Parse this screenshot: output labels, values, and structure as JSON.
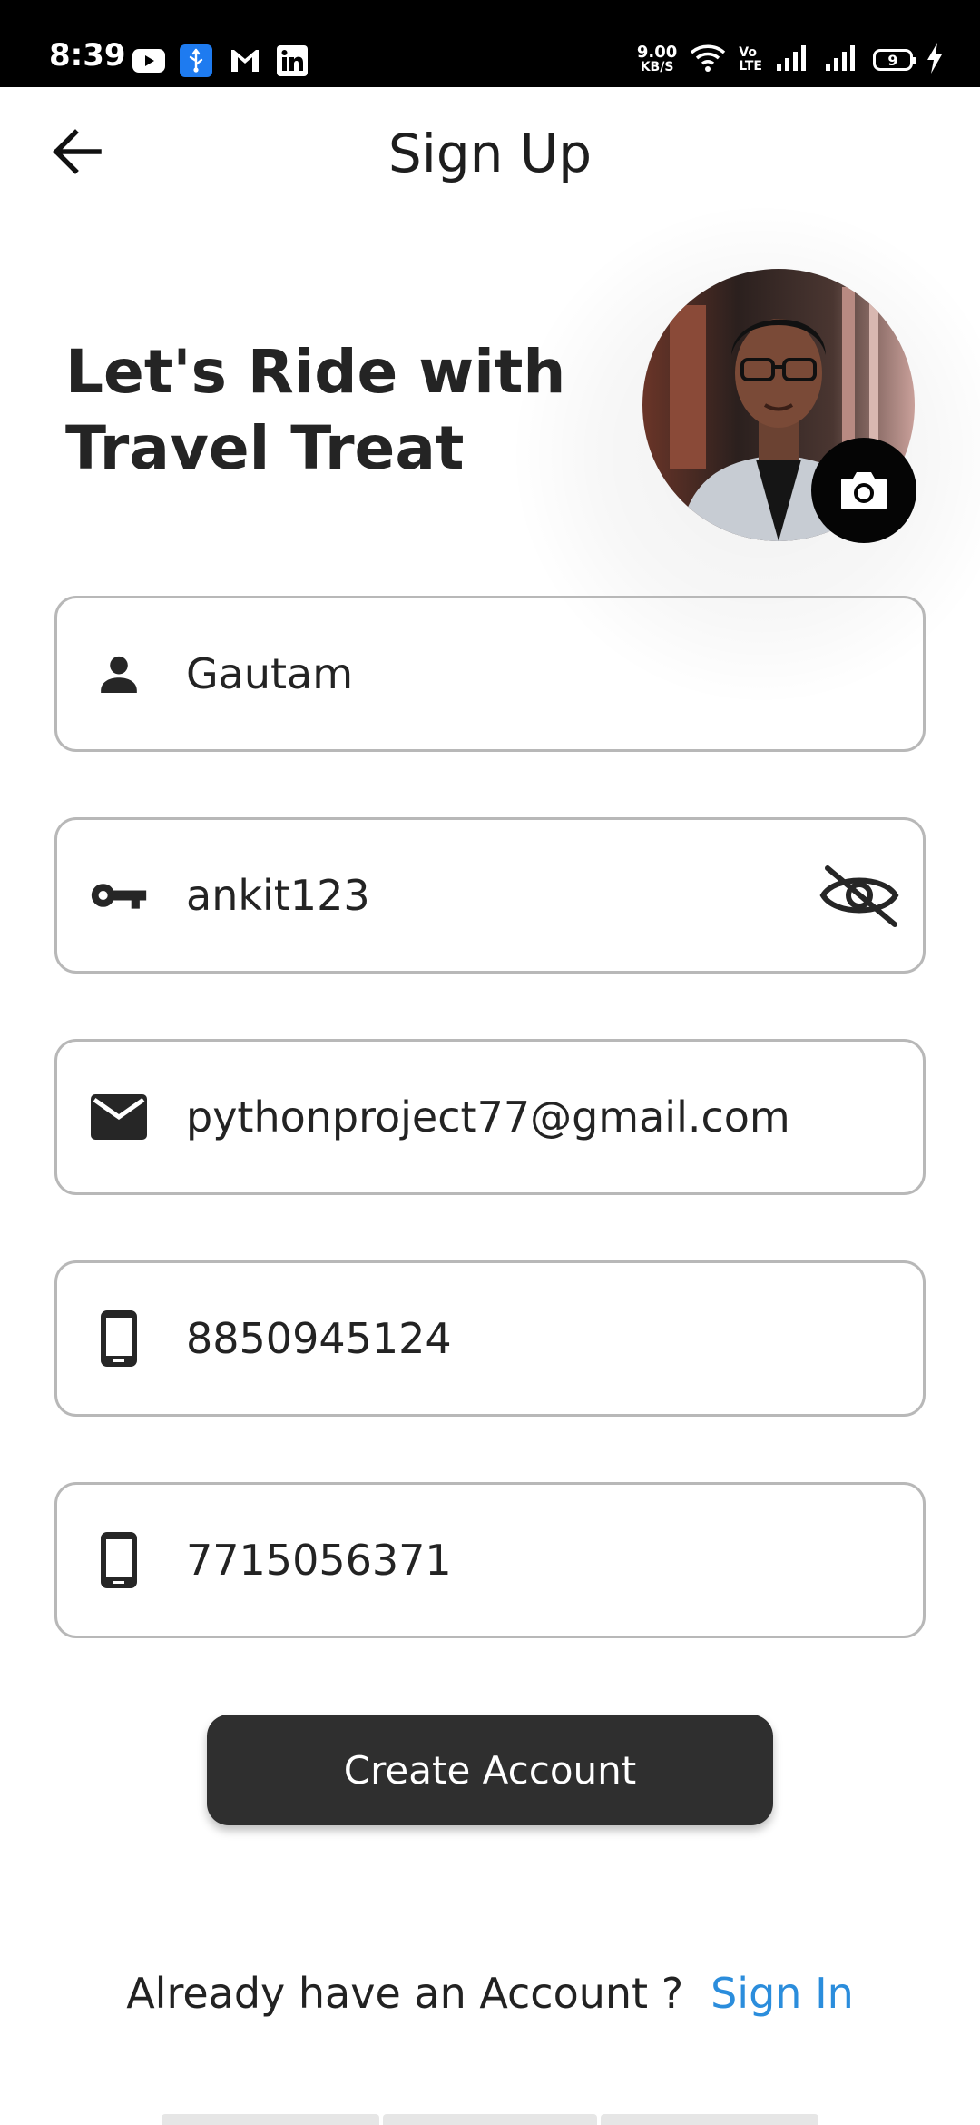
{
  "status_bar": {
    "time": "8:39",
    "net_speed_value": "9.00",
    "net_speed_unit": "KB/S",
    "volte_top": "Vo",
    "volte_bottom": "LTE",
    "battery_level": "9",
    "icons": [
      "youtube-icon",
      "usb-icon",
      "gmail-icon",
      "linkedin-icon",
      "wifi-icon",
      "signal-icon",
      "signal-icon",
      "battery-icon",
      "charging-icon"
    ]
  },
  "app_bar": {
    "title": "Sign Up",
    "back_icon": "arrow-back-icon"
  },
  "header": {
    "headline": "Let's Ride with Travel Treat"
  },
  "form": {
    "name": {
      "value": "Gautam",
      "icon": "person-icon"
    },
    "password": {
      "value": "ankit123",
      "icon": "key-icon",
      "toggle_icon": "eye-off-icon"
    },
    "email": {
      "value": "pythonproject77@gmail.com",
      "icon": "mail-icon"
    },
    "phone": {
      "value": "8850945124",
      "icon": "phone-icon"
    },
    "alt_phone": {
      "value": "7715056371",
      "icon": "phone-icon"
    }
  },
  "actions": {
    "create_account_label": "Create Account",
    "signin_prompt": "Already have an Account ?",
    "signin_link": "Sign In"
  },
  "colors": {
    "button_bg": "#2f2f2f",
    "link": "#2b8ddc",
    "border": "#b8b8b8",
    "status_bar": "#000000"
  }
}
